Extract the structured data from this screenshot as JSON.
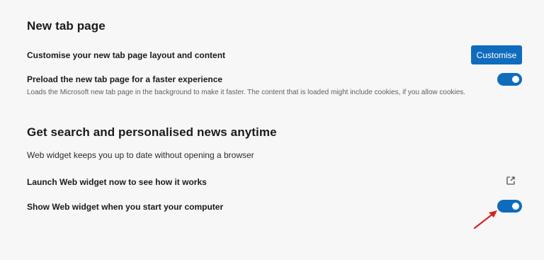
{
  "new_tab_section": {
    "title": "New tab page",
    "customise_row": {
      "label": "Customise your new tab page layout and content",
      "button_label": "Customise"
    },
    "preload_row": {
      "label": "Preload the new tab page for a faster experience",
      "description": "Loads the Microsoft new tab page in the background to make it faster. The content that is loaded might include cookies, if you allow cookies.",
      "enabled": true
    }
  },
  "news_section": {
    "title": "Get search and personalised news anytime",
    "description": "Web widget keeps you up to date without opening a browser",
    "launch_row": {
      "label": "Launch Web widget now to see how it works",
      "icon": "external-link-icon"
    },
    "startup_row": {
      "label": "Show Web widget when you start your computer",
      "enabled": true
    }
  },
  "colors": {
    "accent": "#0f6cbd",
    "annotation_arrow": "#d62222",
    "background": "#f7f7f7"
  }
}
